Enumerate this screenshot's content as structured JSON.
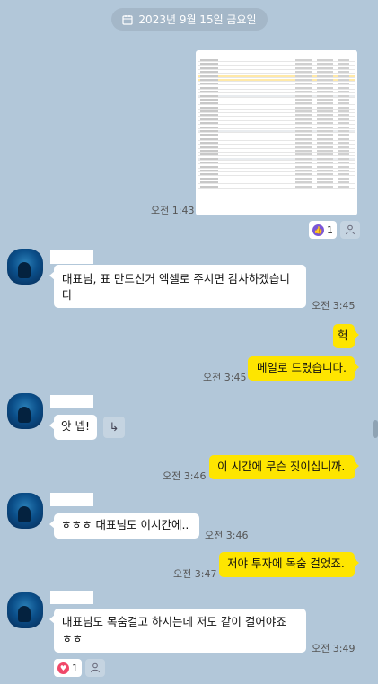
{
  "date_label": "2023년 9월 15일 금요일",
  "messages": [
    {
      "time": "오전 1:43",
      "reaction_count": "1"
    },
    {
      "text": "대표님, 표 만드신거 엑셀로 주시면 감사하겠습니다",
      "time": "오전 3:45"
    },
    {
      "text": "헉"
    },
    {
      "text": "메일로 드렸습니다.",
      "time": "오전 3:45"
    },
    {
      "text": "앗 넵!",
      "reply_icon": "↳"
    },
    {
      "text": "이 시간에 무슨 짓이십니까.",
      "time": "오전 3:46"
    },
    {
      "text": "ㅎㅎㅎ 대표님도 이시간에..",
      "time": "오전 3:46"
    },
    {
      "text": "저야 투자에 목숨 걸었죠.",
      "time": "오전 3:47"
    },
    {
      "text_line1": "대표님도 목숨걸고 하시는데 저도 같이 걸어야죠",
      "text_line2": "ㅎㅎ",
      "time": "오전 3:49",
      "reaction_count": "1"
    }
  ],
  "icons": {
    "calendar": "calendar-icon",
    "thumbs_up_reaction": "thumbs-up-icon",
    "heart_reaction": "heart-icon",
    "add_reaction": "person-icon",
    "reply": "reply-arrow-icon"
  },
  "colors": {
    "background": "#b2c7d9",
    "outgoing_bubble": "#fee500",
    "incoming_bubble": "#ffffff",
    "thumbs_reaction": "#7b57d6",
    "heart_reaction": "#f04869"
  }
}
